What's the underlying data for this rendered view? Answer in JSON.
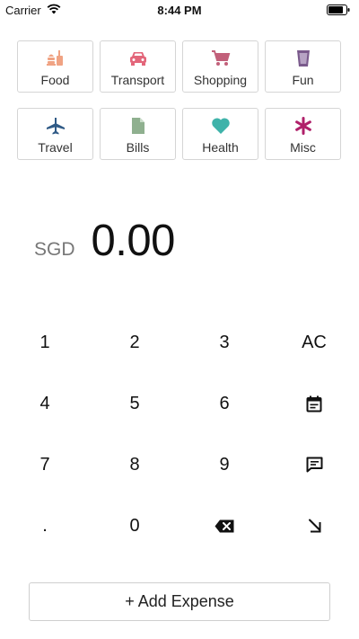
{
  "status_bar": {
    "carrier": "Carrier",
    "time": "8:44 PM"
  },
  "categories": [
    {
      "label": "Food",
      "icon": "food-icon",
      "color": "#f0a383"
    },
    {
      "label": "Transport",
      "icon": "car-icon",
      "color": "#e3667a"
    },
    {
      "label": "Shopping",
      "icon": "cart-icon",
      "color": "#c2607a"
    },
    {
      "label": "Fun",
      "icon": "drink-icon",
      "color": "#7a5a8c"
    },
    {
      "label": "Travel",
      "icon": "plane-icon",
      "color": "#2f5a86"
    },
    {
      "label": "Bills",
      "icon": "document-icon",
      "color": "#8fb08f"
    },
    {
      "label": "Health",
      "icon": "heart-icon",
      "color": "#3fb3aa"
    },
    {
      "label": "Misc",
      "icon": "asterisk-icon",
      "color": "#b0206a"
    }
  ],
  "amount": {
    "currency": "SGD",
    "value": "0.00"
  },
  "keypad": {
    "k1": "1",
    "k2": "2",
    "k3": "3",
    "clear": "AC",
    "k4": "4",
    "k5": "5",
    "k6": "6",
    "k7": "7",
    "k8": "8",
    "k9": "9",
    "dot": ".",
    "k0": "0"
  },
  "add_button": {
    "label": "+ Add Expense"
  }
}
